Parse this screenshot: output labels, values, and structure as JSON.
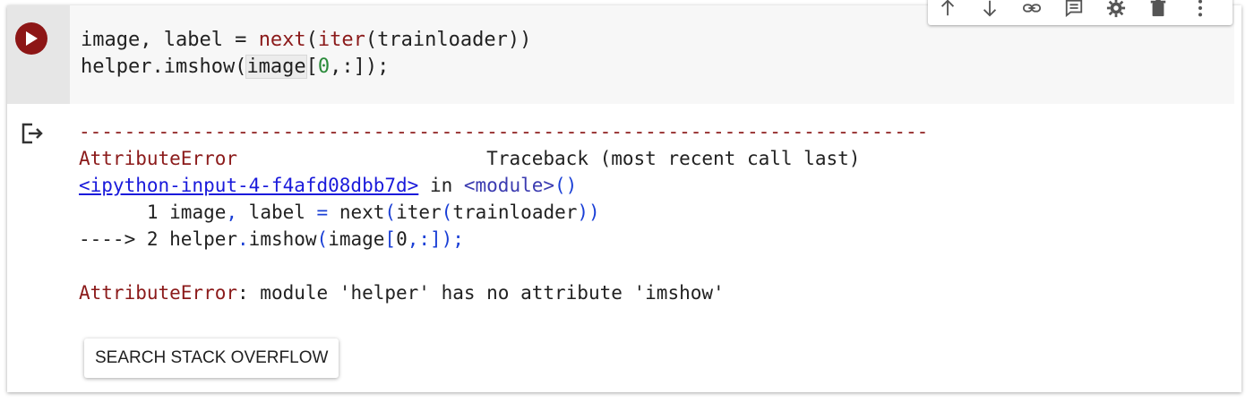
{
  "toolbar": {
    "items": [
      {
        "name": "move-up",
        "icon": "arrow-up-icon"
      },
      {
        "name": "move-down",
        "icon": "arrow-down-icon"
      },
      {
        "name": "link",
        "icon": "link-icon"
      },
      {
        "name": "comment",
        "icon": "comment-icon"
      },
      {
        "name": "settings",
        "icon": "gear-icon"
      },
      {
        "name": "delete",
        "icon": "trash-icon"
      },
      {
        "name": "more",
        "icon": "more-vert-icon"
      }
    ]
  },
  "cell": {
    "run_icon": "play-icon",
    "code": {
      "line1": {
        "a": "image, label = ",
        "next": "next",
        "p1": "(",
        "iter": "iter",
        "p2": "(trainloader))"
      },
      "line2": {
        "a": "helper.imshow(",
        "sel": "image",
        "b": "[",
        "zero": "0",
        "c": ",:]);"
      }
    }
  },
  "output": {
    "icon": "output-redirect-icon",
    "dashes": "---------------------------------------------------------------------------",
    "error_name": "AttributeError",
    "traceback_header": "Traceback (most recent call last)",
    "link_text": "<ipython-input-4-f4afd08dbb7d>",
    "in_text": " in ",
    "module_text": "<module>",
    "module_parens": "()",
    "tb_line1": {
      "prefix": "      1 ",
      "a": "image",
      "comma": ",",
      "b": " label ",
      "eq": "=",
      "c": " next",
      "p1": "(",
      "d": "iter",
      "p2": "(",
      "e": "trainloader",
      "p3": "))"
    },
    "tb_line2": {
      "arrow": "----> 2 ",
      "a": "helper",
      "dot": ".",
      "b": "imshow",
      "p1": "(",
      "c": "image",
      "p2": "[",
      "zero": "0",
      "p3": ",:]);"
    },
    "error_label": "AttributeError",
    "error_message": ": module 'helper' has no attribute 'imshow'",
    "search_button": "SEARCH STACK OVERFLOW"
  }
}
